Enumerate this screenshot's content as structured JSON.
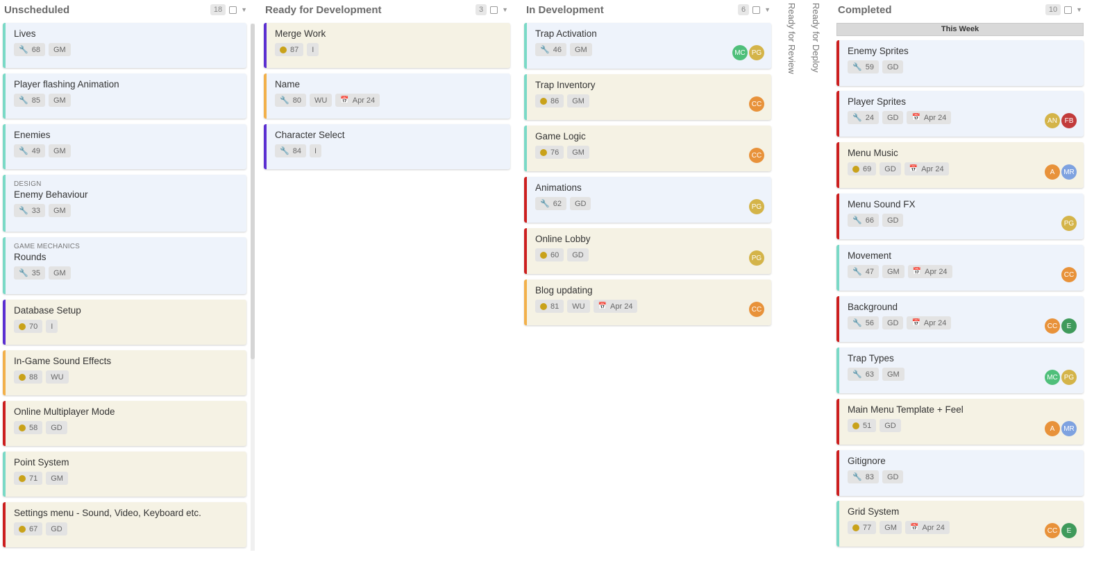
{
  "colors": {
    "teal": "#7ad9c6",
    "purple": "#5b2fd1",
    "orange": "#f2b04a",
    "red": "#cc1f1f",
    "card_blue": "#eef3fb",
    "card_beige": "#f5f2e4"
  },
  "columns": [
    {
      "title": "Unscheduled",
      "count": "18",
      "cards": [
        {
          "category": "",
          "title": "Lives",
          "type": "wrench-icon",
          "points": "68",
          "tag": "GM",
          "date": "",
          "avatars": []
        },
        {
          "category": "",
          "title": "Player flashing Animation",
          "type": "wrench-icon",
          "points": "85",
          "tag": "GM",
          "date": "",
          "avatars": []
        },
        {
          "category": "",
          "title": "Enemies",
          "type": "wrench-icon",
          "points": "49",
          "tag": "GM",
          "date": "",
          "avatars": []
        },
        {
          "category": "DESIGN",
          "title": "Enemy Behaviour",
          "type": "wrench-icon",
          "points": "33",
          "tag": "GM",
          "date": "",
          "avatars": []
        },
        {
          "category": "GAME MECHANICS",
          "title": "Rounds",
          "type": "wrench-icon",
          "points": "35",
          "tag": "GM",
          "date": "",
          "avatars": []
        },
        {
          "category": "",
          "title": "Database Setup",
          "type": "dot-icon",
          "points": "70",
          "tag": "I",
          "date": "",
          "avatars": []
        },
        {
          "category": "",
          "title": "In-Game Sound Effects",
          "type": "dot-icon",
          "points": "88",
          "tag": "WU",
          "date": "",
          "avatars": []
        },
        {
          "category": "",
          "title": "Online Multiplayer Mode",
          "type": "dot-icon",
          "points": "58",
          "tag": "GD",
          "date": "",
          "avatars": []
        },
        {
          "category": "",
          "title": "Point System",
          "type": "dot-icon",
          "points": "71",
          "tag": "GM",
          "date": "",
          "avatars": []
        },
        {
          "category": "",
          "title": "Settings menu - Sound, Video, Keyboard etc.",
          "type": "dot-icon",
          "points": "67",
          "tag": "GD",
          "date": "",
          "avatars": []
        }
      ]
    },
    {
      "title": "Ready for Development",
      "count": "3",
      "cards": [
        {
          "category": "",
          "title": "Merge Work",
          "type": "dot-icon",
          "points": "87",
          "tag": "I",
          "date": "",
          "avatars": []
        },
        {
          "category": "",
          "title": "Name",
          "type": "wrench-icon",
          "points": "80",
          "tag": "WU",
          "date": "Apr 24",
          "avatars": []
        },
        {
          "category": "",
          "title": "Character Select",
          "type": "wrench-icon",
          "points": "84",
          "tag": "I",
          "date": "",
          "avatars": []
        }
      ]
    },
    {
      "title": "In Development",
      "count": "6",
      "cards": [
        {
          "category": "",
          "title": "Trap Activation",
          "type": "wrench-icon",
          "points": "46",
          "tag": "GM",
          "date": "",
          "avatars": [
            {
              "initials": "MC",
              "color": "#4fbf7a"
            },
            {
              "initials": "PG",
              "color": "#d4b449"
            }
          ]
        },
        {
          "category": "",
          "title": "Trap Inventory",
          "type": "dot-icon",
          "points": "86",
          "tag": "GM",
          "date": "",
          "avatars": [
            {
              "initials": "CC",
              "color": "#e8923a"
            }
          ]
        },
        {
          "category": "",
          "title": "Game Logic",
          "type": "dot-icon",
          "points": "76",
          "tag": "GM",
          "date": "",
          "avatars": [
            {
              "initials": "CC",
              "color": "#e8923a"
            }
          ]
        },
        {
          "category": "",
          "title": "Animations",
          "type": "wrench-icon",
          "points": "62",
          "tag": "GD",
          "date": "",
          "avatars": [
            {
              "initials": "PG",
              "color": "#d4b449"
            }
          ]
        },
        {
          "category": "",
          "title": "Online Lobby",
          "type": "dot-icon",
          "points": "60",
          "tag": "GD",
          "date": "",
          "avatars": [
            {
              "initials": "PG",
              "color": "#d4b449"
            }
          ]
        },
        {
          "category": "",
          "title": "Blog updating",
          "type": "dot-icon",
          "points": "81",
          "tag": "WU",
          "date": "Apr 24",
          "avatars": [
            {
              "initials": "CC",
              "color": "#e8923a"
            }
          ]
        }
      ]
    },
    {
      "title": "Completed",
      "count": "10",
      "section": "This Week",
      "cards": [
        {
          "category": "",
          "title": "Enemy Sprites",
          "type": "wrench-icon",
          "points": "59",
          "tag": "GD",
          "date": "",
          "avatars": []
        },
        {
          "category": "",
          "title": "Player Sprites",
          "type": "wrench-icon",
          "points": "24",
          "tag": "GD",
          "date": "Apr 24",
          "avatars": [
            {
              "initials": "AN",
              "color": "#d4b449"
            },
            {
              "initials": "FB",
              "color": "#c23b3b"
            }
          ]
        },
        {
          "category": "",
          "title": "Menu Music",
          "type": "dot-icon",
          "points": "69",
          "tag": "GD",
          "date": "Apr 24",
          "avatars": [
            {
              "initials": "A",
              "color": "#e8923a"
            },
            {
              "initials": "MR",
              "color": "#7ea2e0"
            }
          ]
        },
        {
          "category": "",
          "title": "Menu Sound FX",
          "type": "wrench-icon",
          "points": "66",
          "tag": "GD",
          "date": "",
          "avatars": [
            {
              "initials": "PG",
              "color": "#d4b449"
            }
          ]
        },
        {
          "category": "",
          "title": "Movement",
          "type": "wrench-icon",
          "points": "47",
          "tag": "GM",
          "date": "Apr 24",
          "avatars": [
            {
              "initials": "CC",
              "color": "#e8923a"
            }
          ]
        },
        {
          "category": "",
          "title": "Background",
          "type": "wrench-icon",
          "points": "56",
          "tag": "GD",
          "date": "Apr 24",
          "avatars": [
            {
              "initials": "CC",
              "color": "#e8923a"
            },
            {
              "initials": "E",
              "color": "#3f9a5b"
            }
          ]
        },
        {
          "category": "",
          "title": "Trap Types",
          "type": "wrench-icon",
          "points": "63",
          "tag": "GM",
          "date": "",
          "avatars": [
            {
              "initials": "MC",
              "color": "#4fbf7a"
            },
            {
              "initials": "PG",
              "color": "#d4b449"
            }
          ]
        },
        {
          "category": "",
          "title": "Main Menu Template + Feel",
          "type": "dot-icon",
          "points": "51",
          "tag": "GD",
          "date": "",
          "avatars": [
            {
              "initials": "A",
              "color": "#e8923a"
            },
            {
              "initials": "MR",
              "color": "#7ea2e0"
            }
          ]
        },
        {
          "category": "",
          "title": "Gitignore",
          "type": "wrench-icon",
          "points": "83",
          "tag": "GD",
          "date": "",
          "avatars": []
        },
        {
          "category": "",
          "title": "Grid System",
          "type": "dot-icon",
          "points": "77",
          "tag": "GM",
          "date": "Apr 24",
          "avatars": [
            {
              "initials": "CC",
              "color": "#e8923a"
            },
            {
              "initials": "E",
              "color": "#3f9a5b"
            }
          ]
        }
      ]
    }
  ],
  "collapsed_columns": [
    "Ready for Review",
    "Ready for Deploy"
  ]
}
